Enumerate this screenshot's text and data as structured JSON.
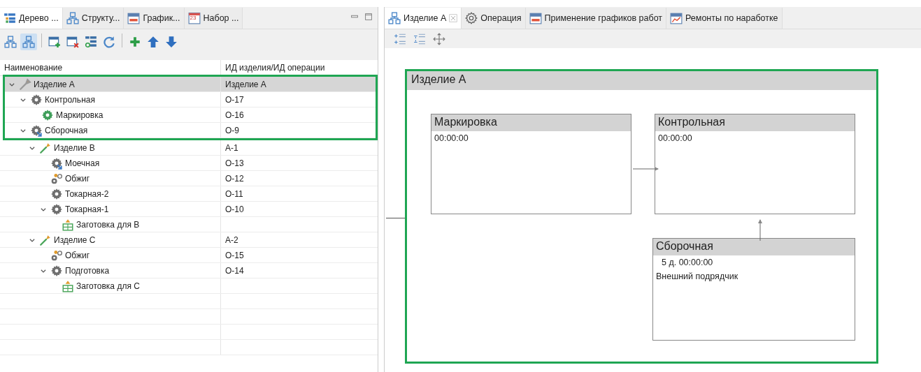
{
  "left_panel": {
    "tabs": [
      {
        "label": "Дерево ...",
        "kind": "tree",
        "selected": true
      },
      {
        "label": "Структу...",
        "kind": "structure",
        "selected": false
      },
      {
        "label": "График...",
        "kind": "calendar",
        "selected": false
      },
      {
        "label": "Набор ...",
        "kind": "date",
        "date": "23",
        "selected": false
      }
    ],
    "toolbar": [
      {
        "kind": "structure",
        "selected": false
      },
      {
        "kind": "structure",
        "selected": true
      },
      {
        "kind": "sep"
      },
      {
        "kind": "add-window",
        "selected": false
      },
      {
        "kind": "remove-window",
        "selected": false
      },
      {
        "kind": "list",
        "selected": false
      },
      {
        "kind": "refresh",
        "selected": false
      },
      {
        "kind": "sep"
      },
      {
        "kind": "plus",
        "selected": false
      },
      {
        "kind": "up",
        "selected": false
      },
      {
        "kind": "down",
        "selected": false
      }
    ],
    "tree": {
      "columns": [
        "Наименование",
        "ИД изделия/ИД операции"
      ],
      "framed": true,
      "rows": [
        {
          "name": "Изделие А",
          "id": "Изделие А",
          "kind": "product",
          "selected": true,
          "expanded": true,
          "children": [
            {
              "name": "Контрольная",
              "id": "О-17",
              "kind": "gear",
              "selected": false,
              "expanded": true,
              "children": [
                {
                  "name": "Маркировка",
                  "id": "О-16",
                  "kind": "gear-green",
                  "selected": false
                }
              ]
            },
            {
              "name": "Сборочная",
              "id": "О-9",
              "kind": "gear-external",
              "selected": false,
              "expanded": true,
              "children": [
                {
                  "name": "Изделие В",
                  "id": "А-1",
                  "kind": "product-green",
                  "selected": false,
                  "expanded": true,
                  "children": [
                    {
                      "name": "Моечная",
                      "id": "О-13",
                      "kind": "gear-external",
                      "selected": false
                    },
                    {
                      "name": "Обжиг",
                      "id": "О-12",
                      "kind": "gears",
                      "selected": false
                    },
                    {
                      "name": "Токарная-2",
                      "id": "О-11",
                      "kind": "gear",
                      "selected": false
                    },
                    {
                      "name": "Токарная-1",
                      "id": "О-10",
                      "kind": "gear",
                      "selected": false,
                      "expanded": true,
                      "children": [
                        {
                          "name": "Заготовка для В",
                          "kind": "blank",
                          "selected": false
                        }
                      ]
                    }
                  ]
                },
                {
                  "name": "Изделие С",
                  "id": "А-2",
                  "kind": "product-green",
                  "selected": false,
                  "expanded": true,
                  "children": [
                    {
                      "name": "Обжиг",
                      "id": "О-15",
                      "kind": "gears",
                      "selected": false
                    },
                    {
                      "name": "Подготовка",
                      "id": "О-14",
                      "kind": "gear",
                      "selected": false,
                      "expanded": true,
                      "children": [
                        {
                          "name": "Заготовка для С",
                          "kind": "blank",
                          "selected": false
                        }
                      ]
                    }
                  ]
                }
              ]
            }
          ]
        }
      ]
    }
  },
  "right_panel": {
    "tabs": [
      {
        "label": "Изделие А",
        "kind": "structure",
        "closable": true,
        "selected": true
      },
      {
        "label": "Операция",
        "kind": "gear-outline",
        "selected": false
      },
      {
        "label": "Применение графиков работ",
        "kind": "calendar",
        "selected": false
      },
      {
        "label": "Ремонты по наработке",
        "kind": "calendar-chart",
        "selected": false
      }
    ],
    "toolbar": [
      {
        "kind": "expand-list"
      },
      {
        "kind": "collapse-list"
      },
      {
        "kind": "move"
      }
    ],
    "diagram": {
      "framed": true,
      "group": {
        "title": "Изделие А"
      },
      "nodes": [
        {
          "title": "Маркировка",
          "lines": [
            "00:00:00"
          ]
        },
        {
          "title": "Контрольная",
          "lines": [
            "00:00:00"
          ]
        },
        {
          "title": "Сборочная",
          "lines": [
            "5 д. 00:00:00",
            "Внешний подрядчик"
          ]
        }
      ]
    }
  }
}
